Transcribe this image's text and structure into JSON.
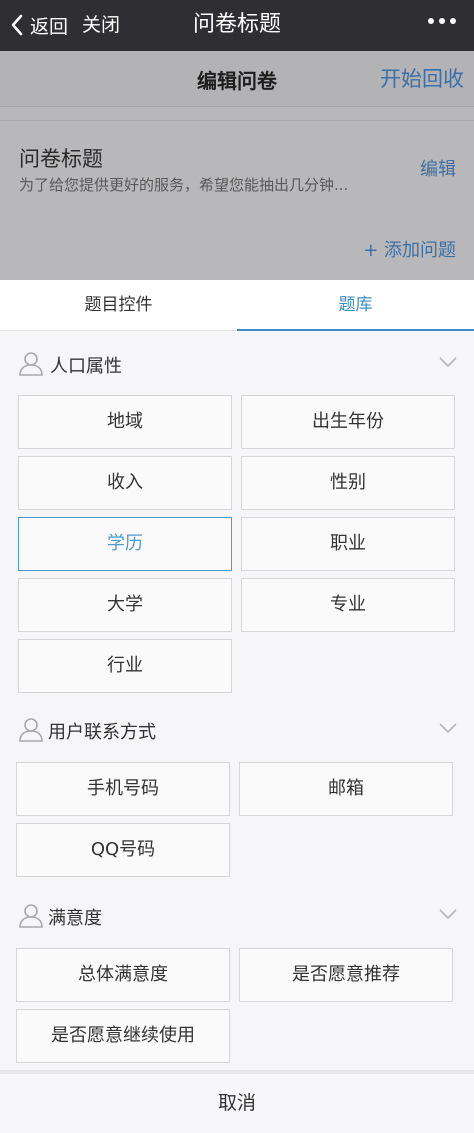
{
  "nav": {
    "back_label": "返回",
    "close_label": "关闭",
    "title": "问卷标题"
  },
  "underlay": {
    "header_title": "编辑问卷",
    "start_collect": "开始回收",
    "survey_title": "问卷标题",
    "survey_desc": "为了给您提供更好的服务，希望您能抽出几分钟...",
    "edit_label": "编辑",
    "add_question": "+ 添加问题"
  },
  "tabs": [
    {
      "label": "题目控件",
      "active": false
    },
    {
      "label": "题库",
      "active": true
    }
  ],
  "sections": [
    {
      "label": "人口属性",
      "options": [
        "地域",
        "出生年份",
        "收入",
        "性别",
        "学历",
        "职业",
        "大学",
        "专业",
        "行业"
      ],
      "selected": "学历"
    },
    {
      "label": "用户联系方式",
      "options": [
        "手机号码",
        "邮箱",
        "QQ号码"
      ]
    },
    {
      "label": "满意度",
      "options": [
        "总体满意度",
        "是否愿意推荐",
        "是否愿意继续使用"
      ]
    }
  ],
  "cancel_label": "取消",
  "colors": {
    "accent": "#3a8ec4",
    "navbar": "#2f2f33",
    "link": "#3c6fa6"
  }
}
